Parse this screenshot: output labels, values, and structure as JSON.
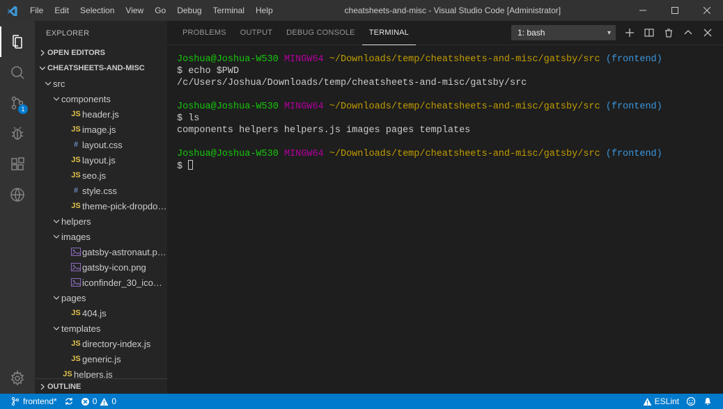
{
  "title": "cheatsheets-and-misc - Visual Studio Code [Administrator]",
  "menu": [
    "File",
    "Edit",
    "Selection",
    "View",
    "Go",
    "Debug",
    "Terminal",
    "Help"
  ],
  "activity_badge_scm": "1",
  "sidebar": {
    "title": "EXPLORER",
    "open_editors_label": "OPEN EDITORS",
    "project_label": "CHEATSHEETS-AND-MISC",
    "outline_label": "OUTLINE"
  },
  "tree": [
    {
      "type": "folder",
      "depth": 0,
      "open": true,
      "label": "src"
    },
    {
      "type": "folder",
      "depth": 1,
      "open": true,
      "label": "components"
    },
    {
      "type": "file",
      "depth": 2,
      "icon": "js",
      "label": "header.js"
    },
    {
      "type": "file",
      "depth": 2,
      "icon": "js",
      "label": "image.js"
    },
    {
      "type": "file",
      "depth": 2,
      "icon": "css",
      "label": "layout.css"
    },
    {
      "type": "file",
      "depth": 2,
      "icon": "js",
      "label": "layout.js"
    },
    {
      "type": "file",
      "depth": 2,
      "icon": "js",
      "label": "seo.js"
    },
    {
      "type": "file",
      "depth": 2,
      "icon": "css",
      "label": "style.css"
    },
    {
      "type": "file",
      "depth": 2,
      "icon": "js",
      "label": "theme-pick-dropdo…"
    },
    {
      "type": "folder",
      "depth": 1,
      "open": true,
      "label": "helpers"
    },
    {
      "type": "folder",
      "depth": 1,
      "open": true,
      "label": "images"
    },
    {
      "type": "file",
      "depth": 2,
      "icon": "img",
      "label": "gatsby-astronaut.png"
    },
    {
      "type": "file",
      "depth": 2,
      "icon": "img",
      "label": "gatsby-icon.png"
    },
    {
      "type": "file",
      "depth": 2,
      "icon": "img",
      "label": "iconfinder_30_icons…"
    },
    {
      "type": "folder",
      "depth": 1,
      "open": true,
      "label": "pages"
    },
    {
      "type": "file",
      "depth": 2,
      "icon": "js",
      "label": "404.js"
    },
    {
      "type": "folder",
      "depth": 1,
      "open": true,
      "label": "templates"
    },
    {
      "type": "file",
      "depth": 2,
      "icon": "js",
      "label": "directory-index.js"
    },
    {
      "type": "file",
      "depth": 2,
      "icon": "js",
      "label": "generic.js"
    },
    {
      "type": "file",
      "depth": 1,
      "icon": "js",
      "label": "helpers.js"
    }
  ],
  "panel": {
    "tabs": {
      "problems": "PROBLEMS",
      "output": "OUTPUT",
      "debug": "DEBUG CONSOLE",
      "terminal": "TERMINAL"
    },
    "terminal_select": "1: bash"
  },
  "terminal": {
    "p1_user": "Joshua@Joshua-W530",
    "p1_sys": "MINGW64",
    "p1_path": "~/Downloads/temp/cheatsheets-and-misc/gatsby/src",
    "p1_branch": "(frontend)",
    "cmd1": "$ echo $PWD",
    "out1": "/c/Users/Joshua/Downloads/temp/cheatsheets-and-misc/gatsby/src",
    "cmd2": "$ ls",
    "out2": "components  helpers  helpers.js  images  pages  templates",
    "cmd3": "$ "
  },
  "status": {
    "branch": "frontend*",
    "errors": "0",
    "warnings": "0",
    "eslint": "ESLint"
  }
}
